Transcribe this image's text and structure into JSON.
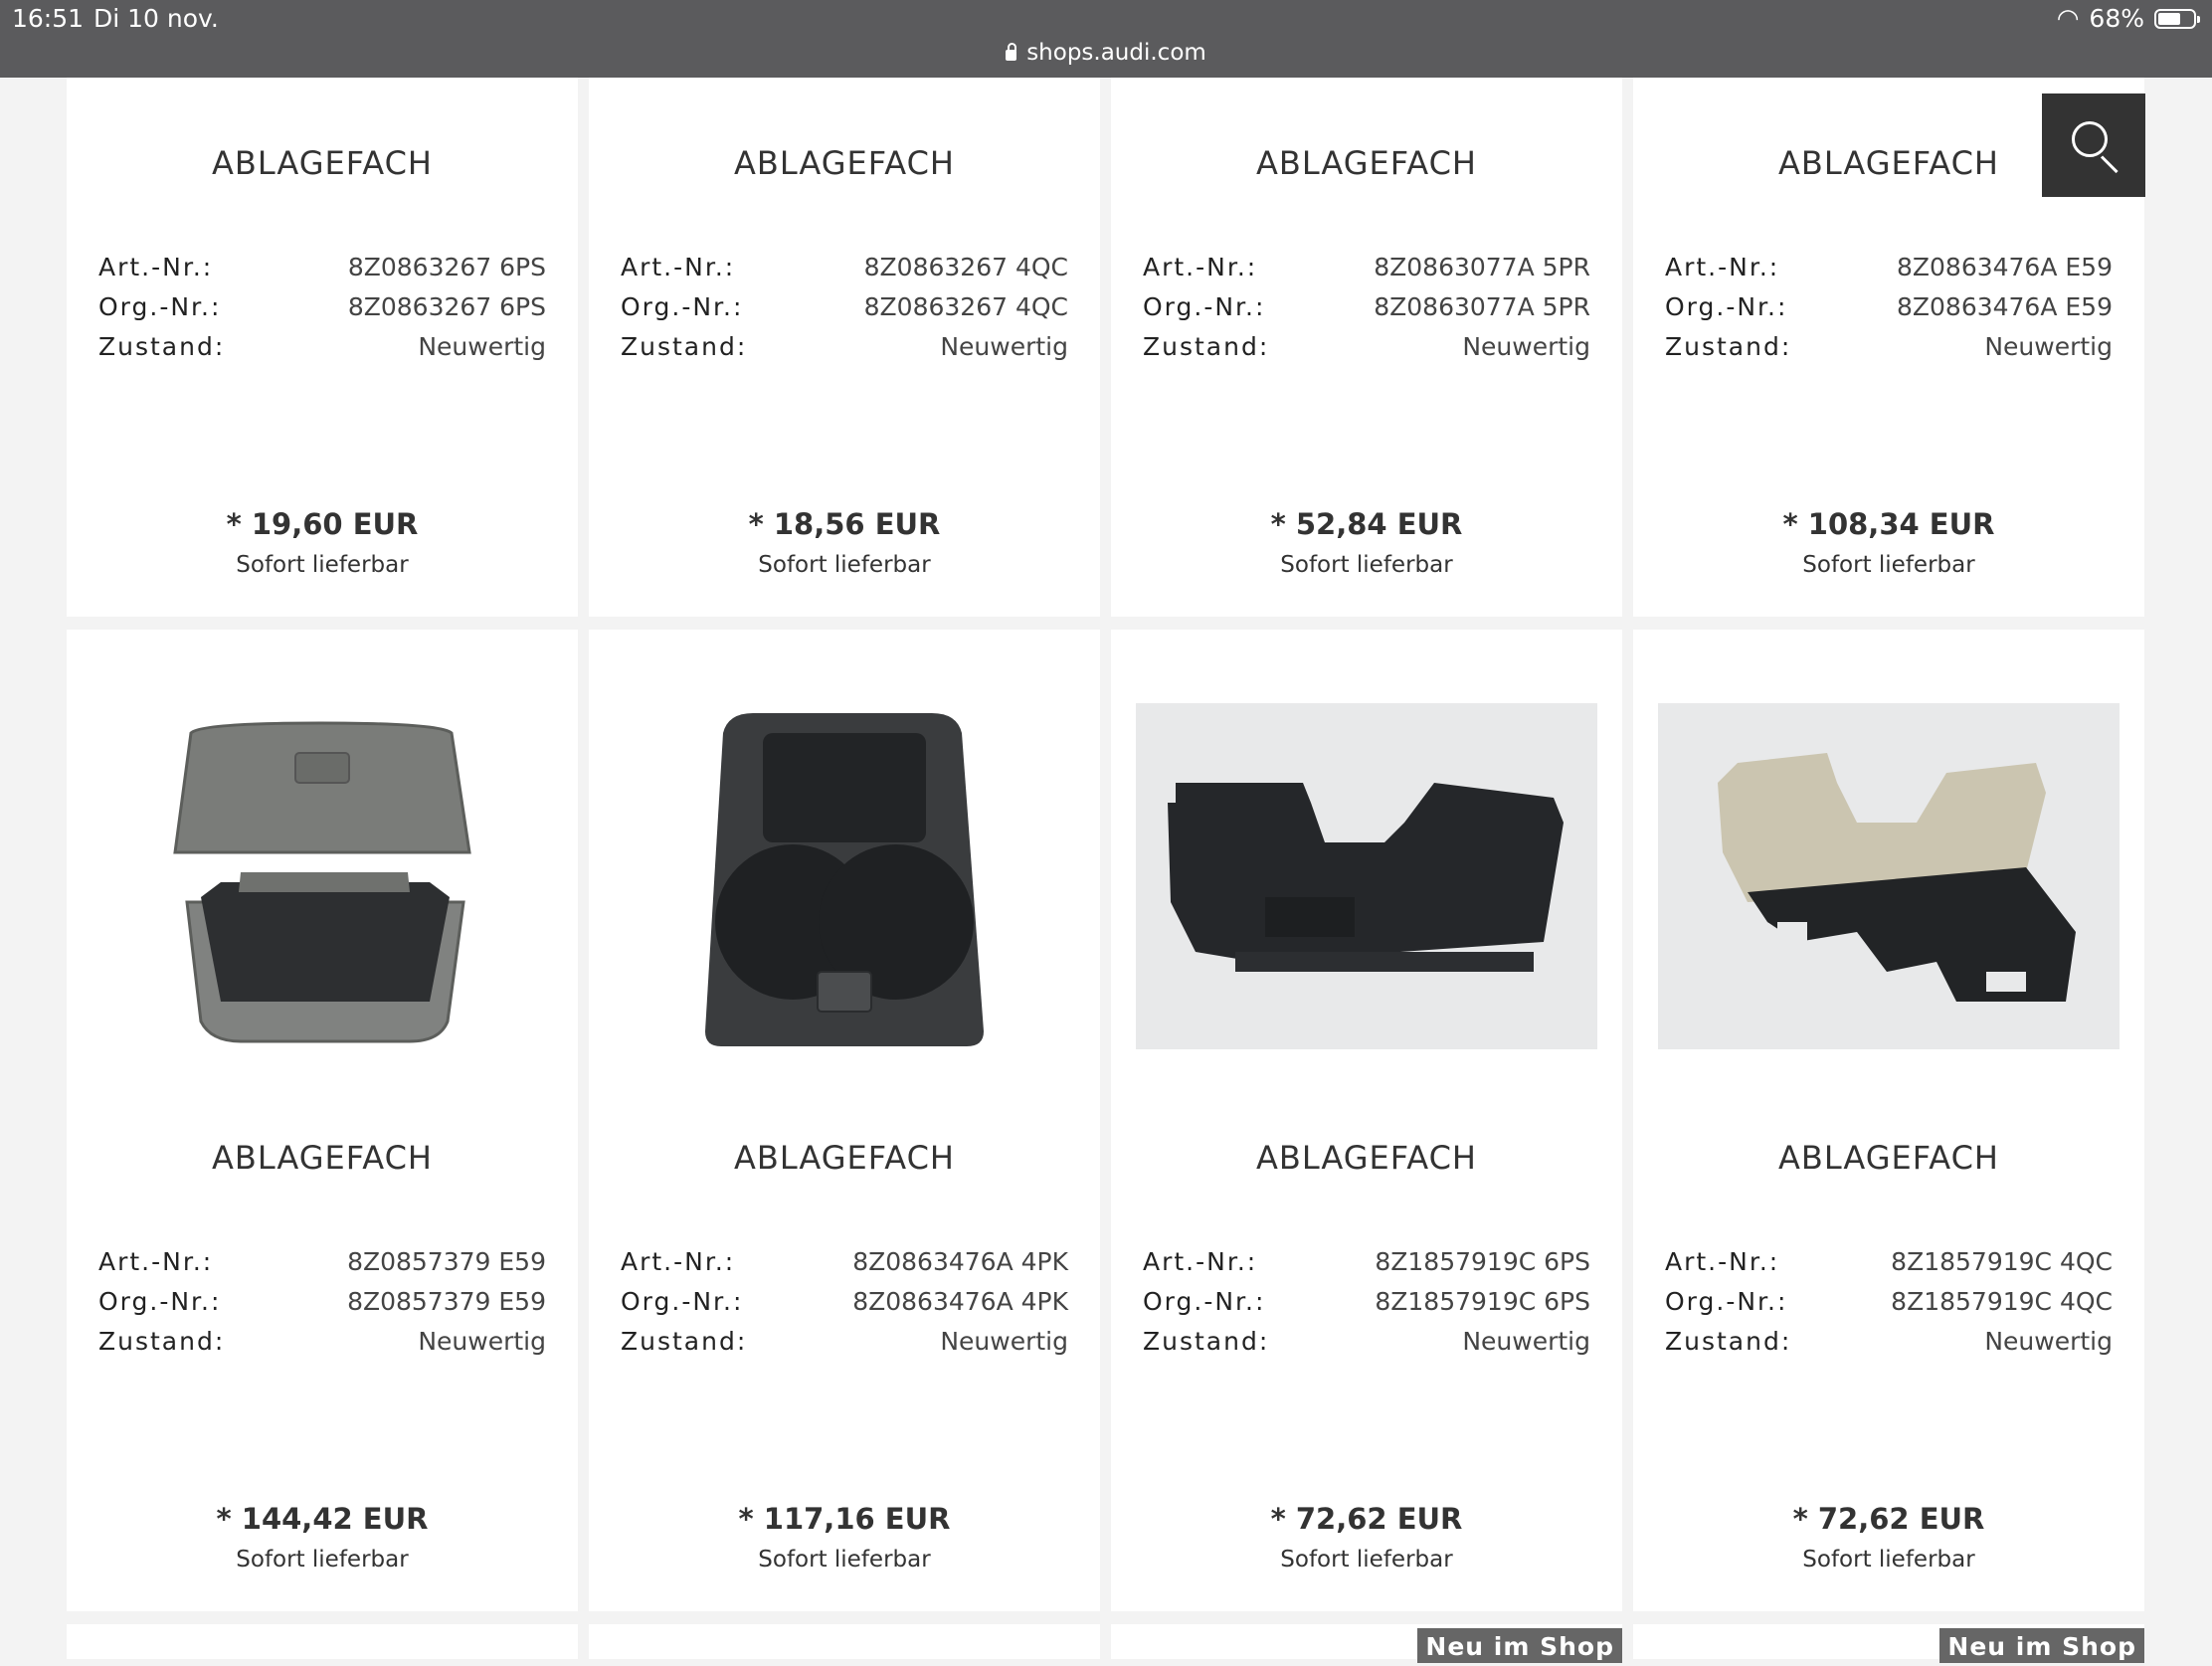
{
  "status_bar": {
    "time": "16:51",
    "date": "Di 10 nov.",
    "battery": "68%",
    "battery_level": 0.68,
    "url": "shops.audi.com"
  },
  "labels": {
    "art": "Art.-Nr.:",
    "org": "Org.-Nr.:",
    "state": "Zustand:",
    "availability": "Sofort lieferbar",
    "badge": "Neu im Shop"
  },
  "products": [
    {
      "title": "ABLAGEFACH",
      "art": "8Z0863267 6PS",
      "org": "8Z0863267 6PS",
      "state": "Neuwertig",
      "price": "* 19,60 EUR"
    },
    {
      "title": "ABLAGEFACH",
      "art": "8Z0863267 4QC",
      "org": "8Z0863267 4QC",
      "state": "Neuwertig",
      "price": "* 18,56 EUR"
    },
    {
      "title": "ABLAGEFACH",
      "art": "8Z0863077A 5PR",
      "org": "8Z0863077A 5PR",
      "state": "Neuwertig",
      "price": "* 52,84 EUR"
    },
    {
      "title": "ABLAGEFACH",
      "art": "8Z0863476A E59",
      "org": "8Z0863476A E59",
      "state": "Neuwertig",
      "price": "* 108,34 EUR"
    },
    {
      "title": "ABLAGEFACH",
      "art": "8Z0857379 E59",
      "org": "8Z0857379 E59",
      "state": "Neuwertig",
      "price": "* 144,42 EUR"
    },
    {
      "title": "ABLAGEFACH",
      "art": "8Z0863476A 4PK",
      "org": "8Z0863476A 4PK",
      "state": "Neuwertig",
      "price": "* 117,16 EUR"
    },
    {
      "title": "ABLAGEFACH",
      "art": "8Z1857919C 6PS",
      "org": "8Z1857919C 6PS",
      "state": "Neuwertig",
      "price": "* 72,62 EUR"
    },
    {
      "title": "ABLAGEFACH",
      "art": "8Z1857919C 4QC",
      "org": "8Z1857919C 4QC",
      "state": "Neuwertig",
      "price": "* 72,62 EUR"
    }
  ]
}
